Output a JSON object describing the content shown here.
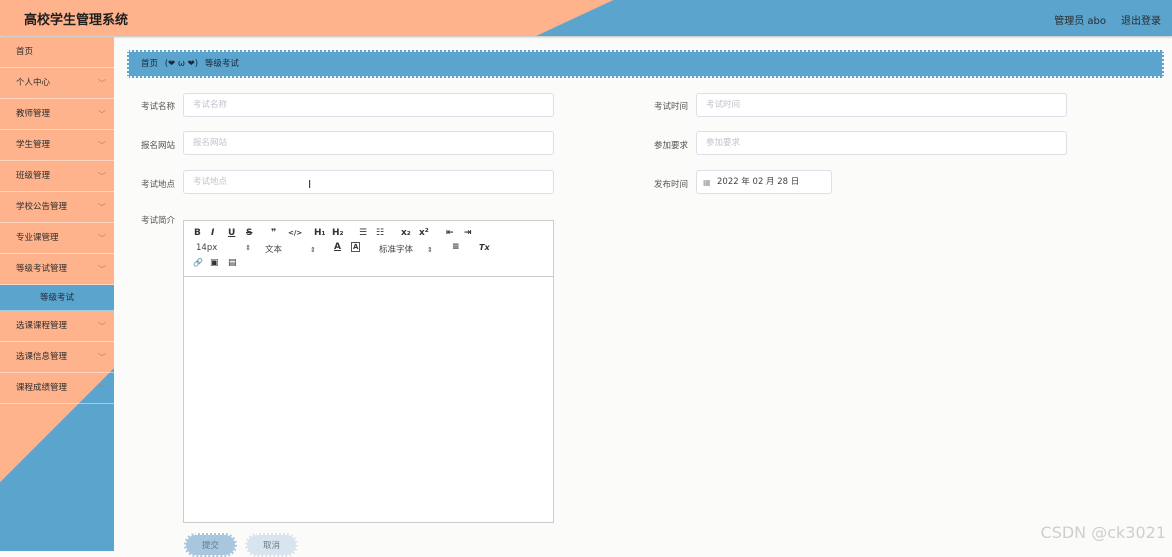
{
  "header": {
    "title": "高校学生管理系统",
    "user": "管理员 abo",
    "logout": "退出登录"
  },
  "sidebar": {
    "items": [
      {
        "label": "首页",
        "chevron": ""
      },
      {
        "label": "个人中心",
        "chevron": "﹀"
      },
      {
        "label": "教师管理",
        "chevron": "﹀"
      },
      {
        "label": "学生管理",
        "chevron": "﹀"
      },
      {
        "label": "班级管理",
        "chevron": "﹀"
      },
      {
        "label": "学校公告管理",
        "chevron": "﹀"
      },
      {
        "label": "专业课管理",
        "chevron": "﹀"
      },
      {
        "label": "等级考试管理",
        "chevron": "﹀"
      }
    ],
    "sub_item": "等级考试",
    "items_after": [
      {
        "label": "选课课程管理",
        "chevron": "﹀"
      },
      {
        "label": "选课信息管理",
        "chevron": "﹀"
      },
      {
        "label": "课程成绩管理",
        "chevron": "﹀"
      }
    ]
  },
  "breadcrumb": {
    "home": "首页",
    "separator": "(❤ ω ❤)",
    "current": "等级考试"
  },
  "form": {
    "exam_name": {
      "label": "考试名称",
      "placeholder": "考试名称"
    },
    "signup_site": {
      "label": "报名网站",
      "placeholder": "报名网站"
    },
    "exam_location": {
      "label": "考试地点",
      "placeholder": "考试地点"
    },
    "exam_intro": {
      "label": "考试简介"
    },
    "exam_time": {
      "label": "考试时间",
      "placeholder": "考试时间"
    },
    "requirements": {
      "label": "参加要求",
      "placeholder": "参加要求"
    },
    "publish_time": {
      "label": "发布时间",
      "value": "2022 年 02 月 28 日"
    }
  },
  "editor": {
    "row1": [
      "B",
      "I",
      "U",
      "S",
      "❞",
      "</>",
      "H₁",
      "H₂",
      "☰",
      "☷",
      "x₂",
      "x²",
      "⇤",
      "⇥"
    ],
    "font_size": "14px",
    "text_style": "文本",
    "font_family": "标准字体",
    "row2_icons": [
      "A",
      "Ā",
      "≡",
      "Tx"
    ],
    "row3": [
      "🔗",
      "▣",
      "▤"
    ],
    "select_arrow": "⇕",
    "calendar_glyph": "▦",
    "text_cursor": "I"
  },
  "buttons": {
    "submit": "提交",
    "cancel": "取消"
  },
  "watermark": "CSDN @ck3021"
}
